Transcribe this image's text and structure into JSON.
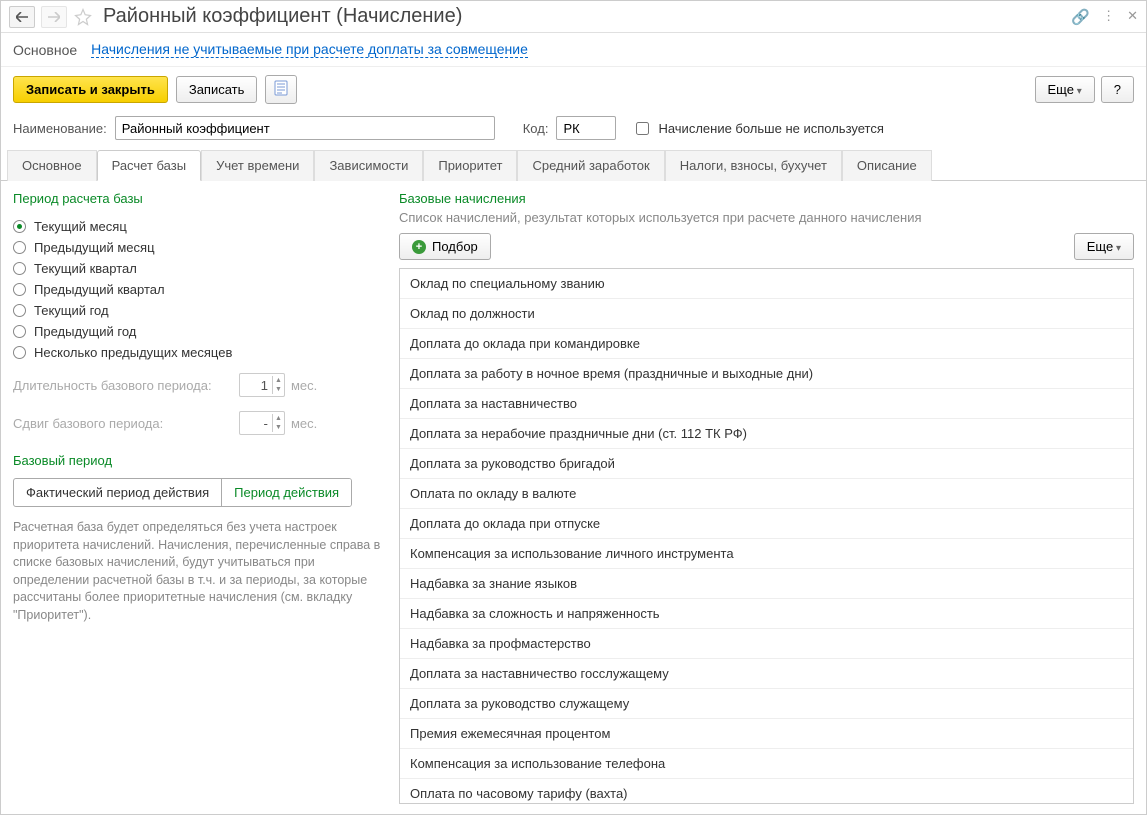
{
  "titlebar": {
    "title": "Районный коэффициент (Начисление)"
  },
  "toplinks": {
    "main": "Основное",
    "link": "Начисления не учитываемые при расчете доплаты за совмещение"
  },
  "toolbar": {
    "save_close": "Записать и закрыть",
    "save": "Записать",
    "more": "Еще",
    "help": "?"
  },
  "form": {
    "name_label": "Наименование:",
    "name_value": "Районный коэффициент",
    "code_label": "Код:",
    "code_value": "РК",
    "inactive_label": "Начисление больше не используется"
  },
  "tabs": [
    "Основное",
    "Расчет базы",
    "Учет времени",
    "Зависимости",
    "Приоритет",
    "Средний заработок",
    "Налоги, взносы, бухучет",
    "Описание"
  ],
  "active_tab": 1,
  "left": {
    "period_header": "Период расчета базы",
    "radios": [
      "Текущий месяц",
      "Предыдущий месяц",
      "Текущий квартал",
      "Предыдущий квартал",
      "Текущий год",
      "Предыдущий год",
      "Несколько предыдущих месяцев"
    ],
    "selected_radio": 0,
    "length_label": "Длительность базового периода:",
    "length_value": "1",
    "shift_label": "Сдвиг базового периода:",
    "shift_value": "-",
    "months_suffix": "мес.",
    "base_period_header": "Базовый период",
    "seg_fact": "Фактический период действия",
    "seg_period": "Период действия",
    "hint": "Расчетная база будет определяться без учета настроек приоритета начислений. Начисления, перечисленные справа в списке базовых начислений, будут учитываться при определении расчетной базы в т.ч. и за периоды, за которые рассчитаны более приоритетные начисления (см. вкладку \"Приоритет\")."
  },
  "right": {
    "header": "Базовые начисления",
    "sub": "Список начислений, результат которых используется при расчете данного начисления",
    "pick": "Подбор",
    "more": "Еще",
    "items": [
      "Оклад по специальному званию",
      "Оклад по должности",
      "Доплата до оклада при командировке",
      "Доплата за работу в ночное время (праздничные и выходные дни)",
      "Доплата за наставничество",
      "Доплата за нерабочие праздничные дни (ст. 112 ТК РФ)",
      "Доплата за руководство бригадой",
      "Оплата по окладу в валюте",
      "Доплата до оклада при отпуске",
      "Компенсация за использование личного инструмента",
      "Надбавка за знание языков",
      "Надбавка за сложность и напряженность",
      "Надбавка за профмастерство",
      "Доплата за наставничество госслужащему",
      "Доплата за руководство служащему",
      "Премия ежемесячная процентом",
      "Компенсация за использование телефона",
      "Оплата по часовому тарифу (вахта)"
    ]
  }
}
